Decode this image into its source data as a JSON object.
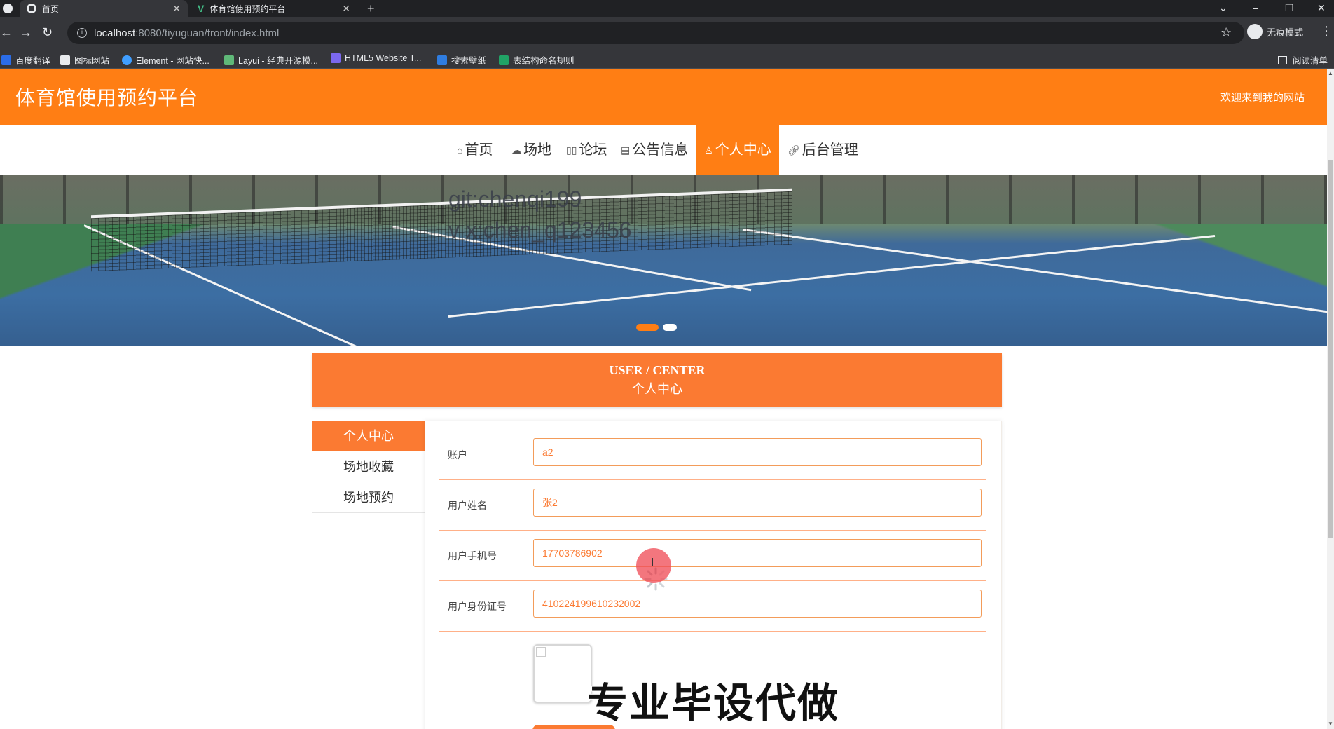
{
  "browser": {
    "tabs": [
      {
        "title": "首页",
        "icon": "globe-icon"
      },
      {
        "title": "体育馆使用预约平台",
        "icon": "vue-icon"
      }
    ],
    "url_host": "localhost",
    "url_path": ":8080/tiyuguan/front/index.html",
    "incognito_label": "无痕模式",
    "bookmarks": [
      "百度翻译",
      "图标网站",
      "Element - 网站快...",
      "Layui - 经典开源模...",
      "HTML5 Website T...",
      "搜索壁纸",
      "表结构命名规则"
    ],
    "reading_list": "阅读清单"
  },
  "site": {
    "title": "体育馆使用预约平台",
    "welcome": "欢迎来到我的网站"
  },
  "nav": {
    "items": [
      {
        "label": "首页",
        "icon": "home-icon"
      },
      {
        "label": "场地",
        "icon": "field-icon"
      },
      {
        "label": "论坛",
        "icon": "forum-icon"
      },
      {
        "label": "公告信息",
        "icon": "notice-icon"
      },
      {
        "label": "个人中心",
        "icon": "user-icon"
      },
      {
        "label": "后台管理",
        "icon": "link-icon"
      }
    ],
    "active_index": 4
  },
  "banner": {
    "watermark_line1": "git:chenqi199",
    "watermark_line2": "v x:chen_q123456",
    "slide_count": 2,
    "active_slide": 0
  },
  "section": {
    "title_en": "USER / CENTER",
    "title_cn": "个人中心"
  },
  "side_menu": {
    "items": [
      "个人中心",
      "场地收藏",
      "场地预约"
    ],
    "active_index": 0
  },
  "form": {
    "fields": [
      {
        "label": "账户",
        "value": "a2"
      },
      {
        "label": "用户姓名",
        "value": "张2"
      },
      {
        "label": "用户手机号",
        "value": "17703786902"
      },
      {
        "label": "用户身份证号",
        "value": "410224199610232002"
      }
    ]
  },
  "overlay_text": "专业毕设代做",
  "colors": {
    "primary": "#ff7e14",
    "section": "#fb7a32",
    "chrome_dark": "#202124",
    "chrome_mid": "#35363a"
  }
}
